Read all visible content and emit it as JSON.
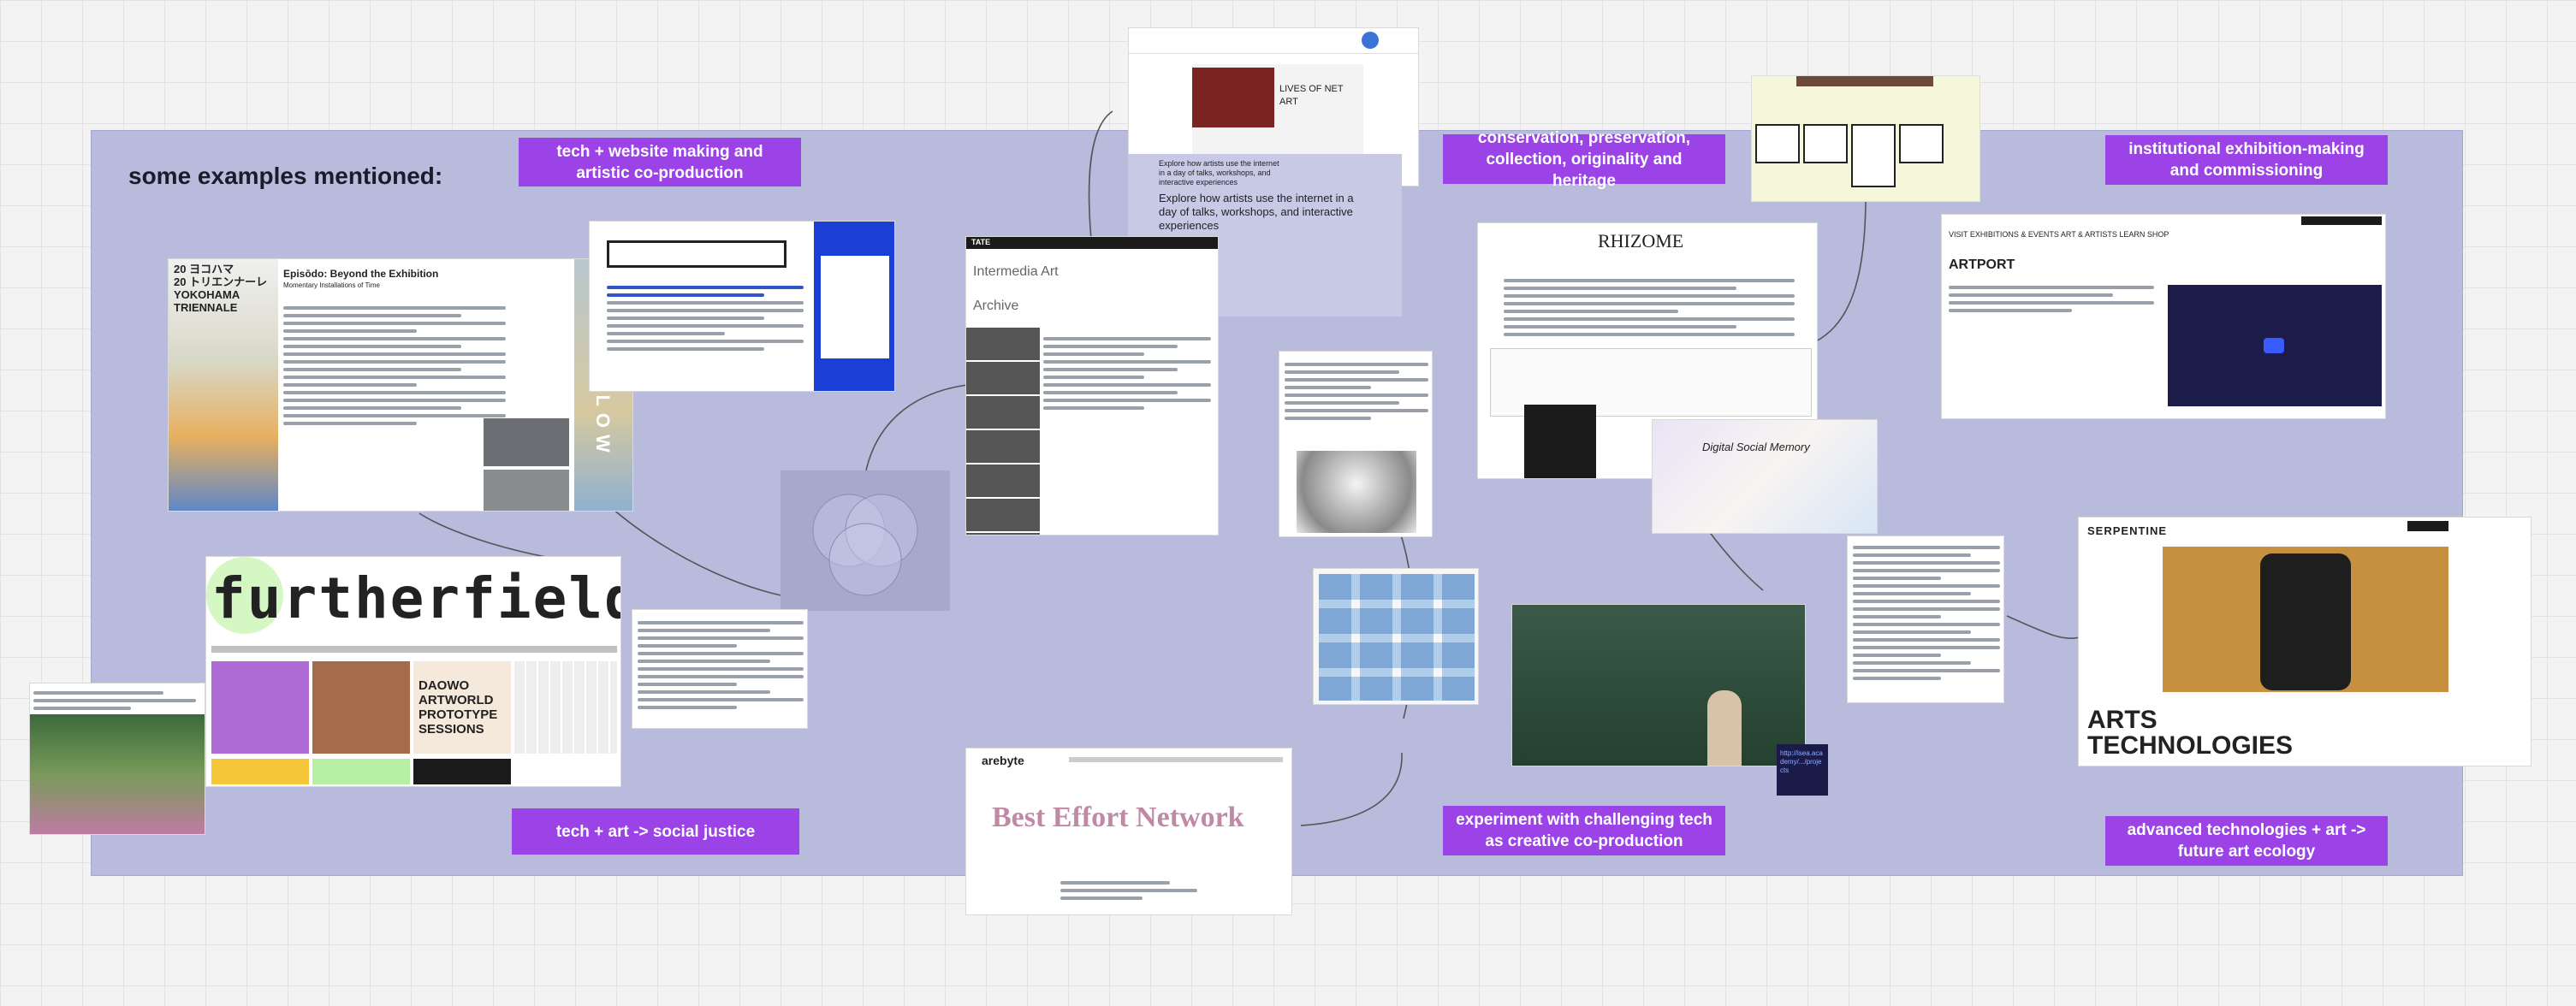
{
  "board": {
    "heading": "some examples mentioned:",
    "labels": [
      "tech + website making and artistic co-production",
      "conservation, preservation, collection, originality and heritage",
      "institutional exhibition-making and commissioning",
      "tech + art -> social justice",
      "experiment with challenging tech as creative co-production",
      "advanced technologies + art -> future art ecology"
    ]
  },
  "cards": {
    "triennale": {
      "logo_line1": "20 ヨコハマ",
      "logo_line2": "20 トリエンナーレ",
      "logo_line3": "YOKOHAMA",
      "logo_line4": "TRIENNALE",
      "title": "Episōdo: Beyond the Exhibition",
      "subtitle": "Momentary Installations of Time",
      "vertical": "AFTERGLOW"
    },
    "net_art": {
      "title": "LIVES OF NET ART",
      "caption": "Explore how artists use the internet in a day of talks, workshops, and interactive experiences",
      "caption_big": "Explore how artists use the internet in a day of talks, workshops, and interactive experiences"
    },
    "tate": {
      "brand": "TATE",
      "section": "Intermedia Art",
      "subsection": "Archive"
    },
    "rhizome": {
      "brand": "RHIZOME"
    },
    "digital_social_memory": {
      "title": "Digital Social Memory"
    },
    "artport": {
      "brand": "ARTPORT",
      "nav": "VISIT   EXHIBITIONS & EVENTS   ART & ARTISTS   LEARN   SHOP"
    },
    "furtherfield": {
      "brand": "furtherfield",
      "tile": "DAOWO ARTWORLD PROTOTYPE SESSIONS"
    },
    "best_effort": {
      "brand": "arebyte",
      "title": "Best Effort Network"
    },
    "serpentine": {
      "brand": "SERPENTINE",
      "line1": "ARTS",
      "line2": "TECHNOLOGIES"
    },
    "link_note": "http://isea.academy/.../projects"
  },
  "colors": {
    "frame": "#b9bbdd",
    "sticky": "#9b43e6",
    "canvas": "#f3f3f3"
  }
}
